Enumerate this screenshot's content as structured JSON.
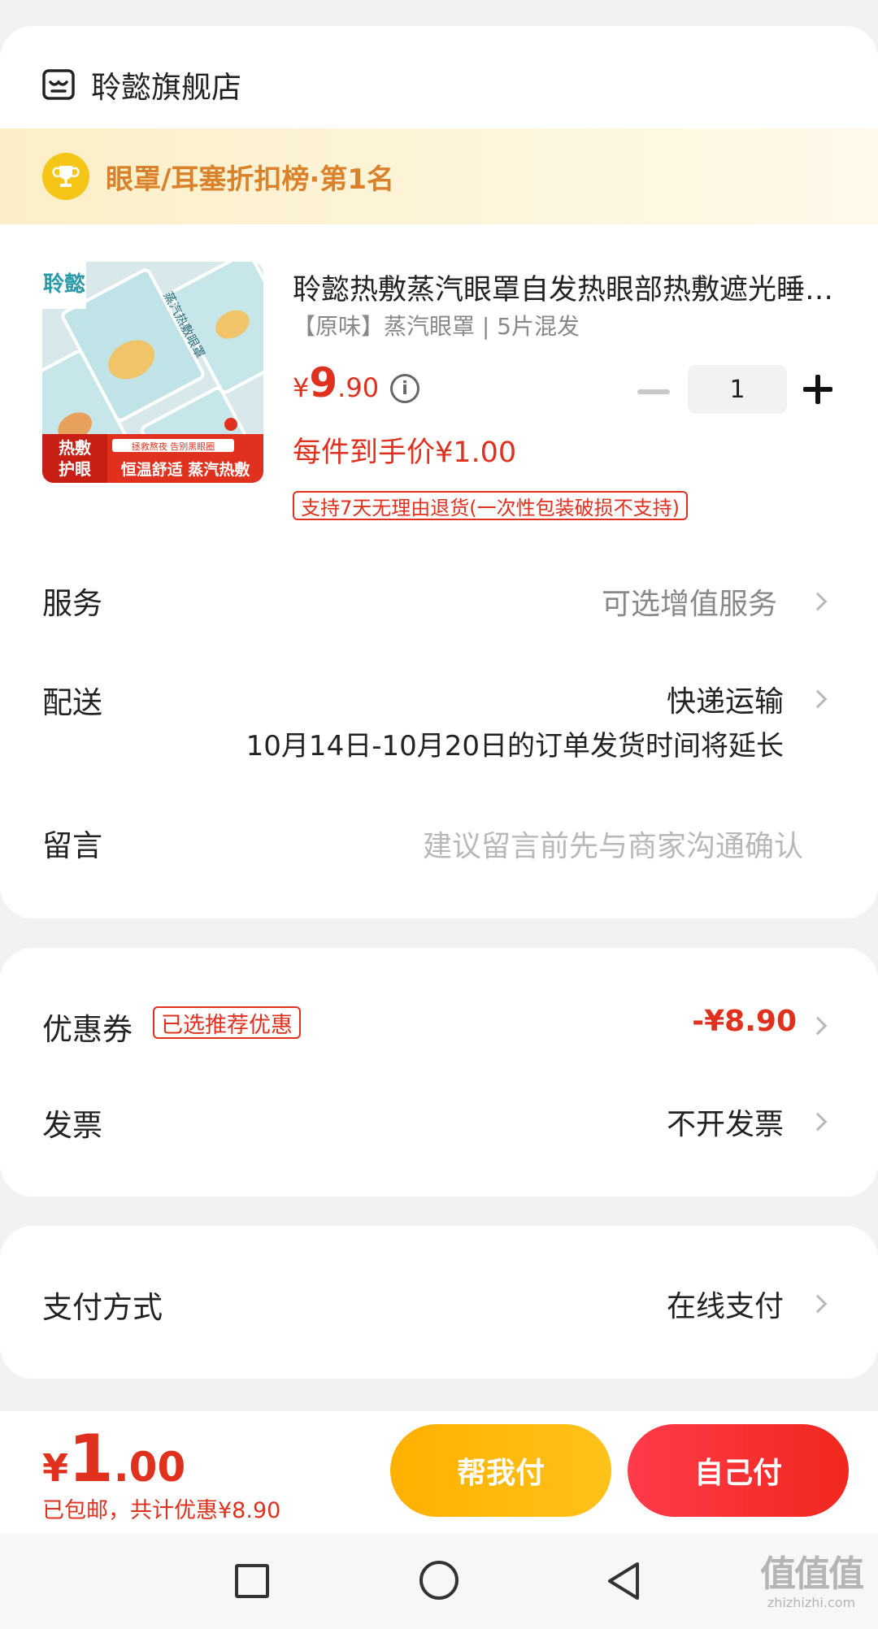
{
  "store": {
    "name": "聆懿旗舰店"
  },
  "rank_banner": {
    "text": "眼罩/耳塞折扣榜·第1名"
  },
  "product": {
    "title": "聆懿热敷蒸汽眼罩自发热眼部热敷遮光睡眠眼罩",
    "sku": "【原味】蒸汽眼罩 | 5片混发",
    "price_symbol": "¥",
    "price_int": "9",
    "price_dec": ".90",
    "quantity": "1",
    "net_price": "每件到手价¥1.00",
    "return_policy": "支持7天无理由退货(一次性包装破损不支持)",
    "image": {
      "brand_text": "聆懿",
      "pack_label": "蒸汽热敷眼罩",
      "badge_left_1": "热敷",
      "badge_left_2": "护眼",
      "slogan_small": "拯救熬夜 告别黑眼圈",
      "slogan_big": "恒温舒适 蒸汽热敷"
    }
  },
  "rows": {
    "service": {
      "label": "服务",
      "value": "可选增值服务"
    },
    "delivery": {
      "label": "配送",
      "value": "快递运输",
      "note": "10月14日-10月20日的订单发货时间将延长"
    },
    "message": {
      "label": "留言",
      "placeholder": "建议留言前先与商家沟通确认"
    },
    "coupon": {
      "label": "优惠券",
      "tag": "已选推荐优惠",
      "value": "-¥8.90"
    },
    "invoice": {
      "label": "发票",
      "value": "不开发票"
    },
    "payment": {
      "label": "支付方式",
      "value": "在线支付"
    }
  },
  "footer": {
    "total_yen": "¥",
    "total_int": "1",
    "total_dec": ".00",
    "note": "已包邮，共计优惠¥8.90",
    "help_pay_label": "帮我付",
    "self_pay_label": "自己付"
  },
  "watermark": {
    "big": "值值值",
    "small": "zhizhizhi.com"
  },
  "colors": {
    "accent_red": "#e0301e",
    "gold": "#ffb000",
    "banner_text": "#d9822b"
  },
  "icons": [
    "store-icon",
    "trophy-icon",
    "info-icon",
    "minus-icon",
    "plus-icon",
    "chevron-right-icon",
    "nav-square-icon",
    "nav-circle-icon",
    "nav-back-icon"
  ]
}
